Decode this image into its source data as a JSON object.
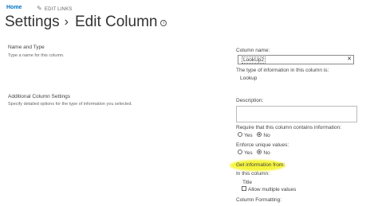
{
  "nav": {
    "home": "Home",
    "edit_links": "EDIT LINKS"
  },
  "header": {
    "settings": "Settings",
    "arrow": "›",
    "page": "Edit Column"
  },
  "sections": {
    "name_type": {
      "heading": "Name and Type",
      "desc": "Type a name for this column."
    },
    "additional": {
      "heading": "Additional Column Settings",
      "desc": "Specify detailed options for the type of information you selected."
    }
  },
  "form": {
    "column_name_label": "Column name:",
    "column_name_value": "LookUp2",
    "type_label": "The type of information in this column is:",
    "type_value": "Lookup",
    "description_label": "Description:",
    "require_label": "Require that this column contains information:",
    "require_yes": "Yes",
    "require_no": "No",
    "unique_label": "Enforce unique values:",
    "unique_yes": "Yes",
    "unique_no": "No",
    "get_info_label": "Get information from:",
    "in_column_label": "In this column:",
    "in_column_value": "Title",
    "allow_multiple": "Allow multiple values",
    "formatting_label": "Column Formatting:"
  },
  "icons": {
    "pencil": "pencil-icon",
    "info": "info-icon",
    "clear": "clear-icon"
  },
  "colors": {
    "link": "#0072c6",
    "highlight": "#f6f52a"
  }
}
